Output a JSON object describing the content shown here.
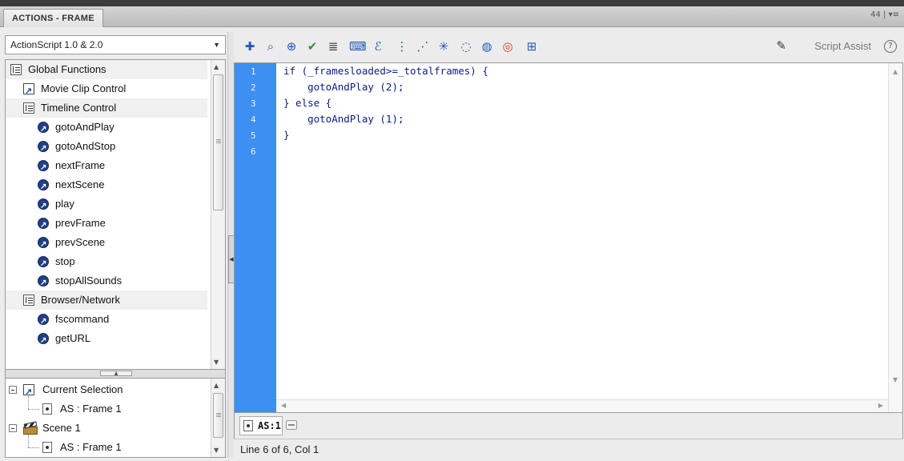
{
  "panel": {
    "tab_title": "ACTIONS - FRAME",
    "controls": "44 | ▾≡"
  },
  "left": {
    "language": "ActionScript 1.0 & 2.0",
    "toolbox": [
      {
        "label": "Global Functions",
        "icon": "book-icon",
        "kind": "category"
      },
      {
        "label": "Movie Clip Control",
        "icon": "movie-clip-icon",
        "kind": "category"
      },
      {
        "label": "Timeline Control",
        "icon": "book-icon",
        "kind": "category"
      },
      {
        "label": "gotoAndPlay",
        "icon": "function-icon",
        "kind": "item"
      },
      {
        "label": "gotoAndStop",
        "icon": "function-icon",
        "kind": "item"
      },
      {
        "label": "nextFrame",
        "icon": "function-icon",
        "kind": "item"
      },
      {
        "label": "nextScene",
        "icon": "function-icon",
        "kind": "item"
      },
      {
        "label": "play",
        "icon": "function-icon",
        "kind": "item"
      },
      {
        "label": "prevFrame",
        "icon": "function-icon",
        "kind": "item"
      },
      {
        "label": "prevScene",
        "icon": "function-icon",
        "kind": "item"
      },
      {
        "label": "stop",
        "icon": "function-icon",
        "kind": "item"
      },
      {
        "label": "stopAllSounds",
        "icon": "function-icon",
        "kind": "item"
      },
      {
        "label": "Browser/Network",
        "icon": "book-icon",
        "kind": "category"
      },
      {
        "label": "fscommand",
        "icon": "function-icon",
        "kind": "item"
      },
      {
        "label": "getURL",
        "icon": "function-icon",
        "kind": "item"
      }
    ],
    "navigator": [
      {
        "label": "Current Selection",
        "icon": "movie-clip-icon"
      },
      {
        "label": "AS : Frame 1",
        "icon": "frame-icon"
      },
      {
        "label": "Scene 1",
        "icon": "scene-icon"
      },
      {
        "label": "AS : Frame 1",
        "icon": "frame-icon"
      }
    ]
  },
  "toolbar": {
    "script_assist": "Script Assist",
    "help": "?"
  },
  "editor": {
    "line_numbers": [
      "1",
      "2",
      "3",
      "4",
      "5",
      "6"
    ],
    "lines": [
      "if (_framesloaded>=_totalframes) {",
      "    gotoAndPlay (2);",
      "} else {",
      "    gotoAndPlay (1);",
      "}",
      ""
    ]
  },
  "script_tab": {
    "label": "AS:1"
  },
  "status": {
    "text": "Line 6 of 6, Col 1"
  },
  "colors": {
    "gutter": "#3d8ff1",
    "code_text": "#0b1b8a"
  }
}
